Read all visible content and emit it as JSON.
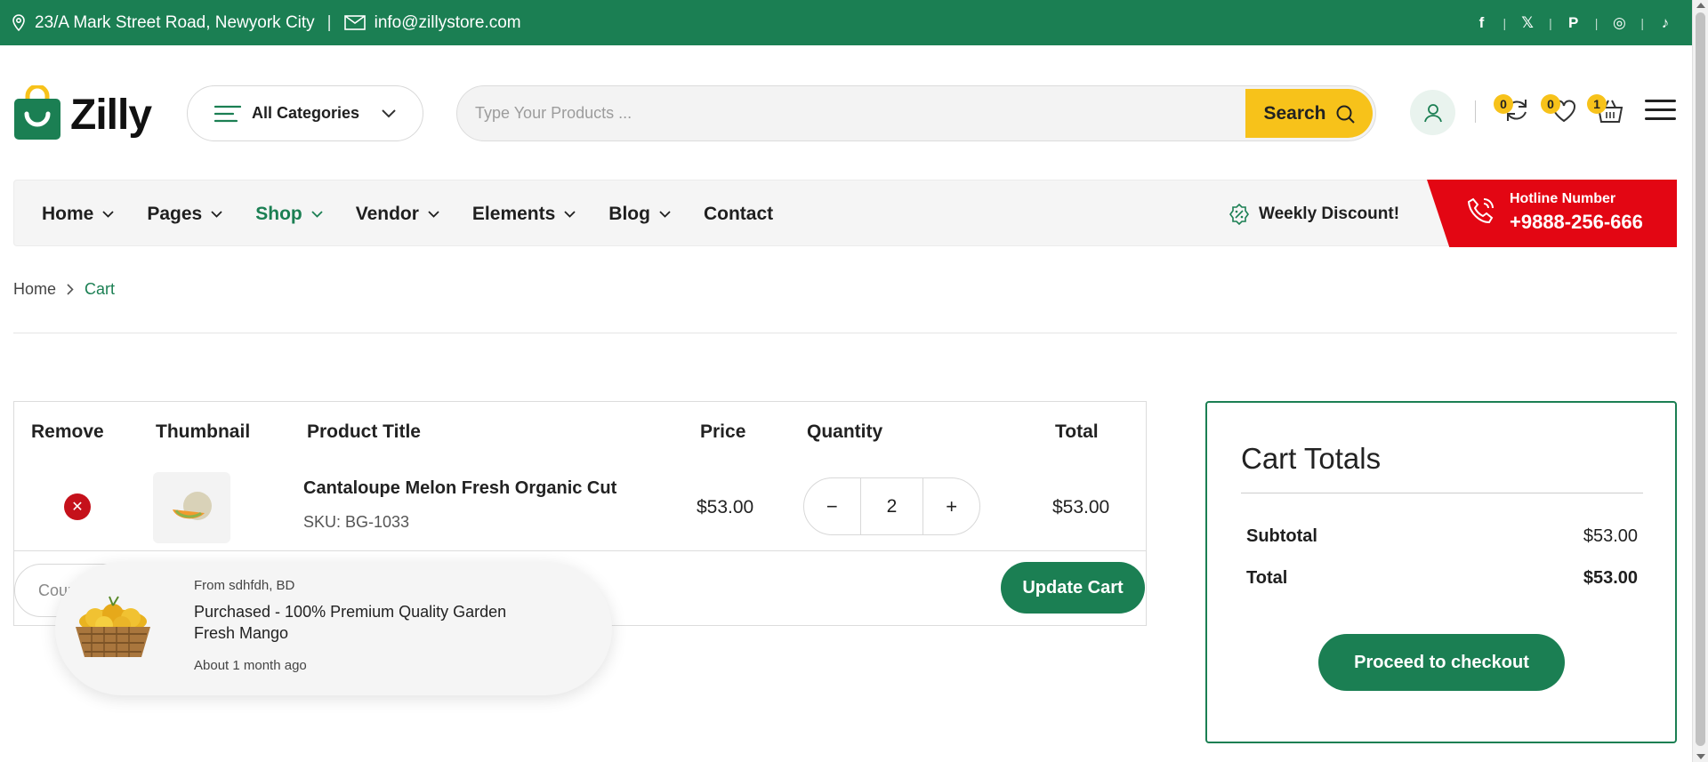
{
  "topbar": {
    "address": "23/A Mark Street Road, Newyork City",
    "separator": "|",
    "email": "info@zillystore.com",
    "social": [
      "f",
      "𝕏",
      "P",
      "◎",
      "♪"
    ],
    "social_names": [
      "facebook-icon",
      "x-icon",
      "pinterest-icon",
      "instagram-icon",
      "tiktok-icon"
    ],
    "bg_color": "#1b7f53"
  },
  "header": {
    "logo_text": "Zilly",
    "categories_label": "All Categories",
    "search_placeholder": "Type Your Products ...",
    "search_button": "Search",
    "compare_count": "0",
    "wishlist_count": "0",
    "cart_count": "1"
  },
  "nav": {
    "items": [
      {
        "label": "Home",
        "dropdown": true
      },
      {
        "label": "Pages",
        "dropdown": true
      },
      {
        "label": "Shop",
        "dropdown": true,
        "active": true
      },
      {
        "label": "Vendor",
        "dropdown": true
      },
      {
        "label": "Elements",
        "dropdown": true
      },
      {
        "label": "Blog",
        "dropdown": true
      },
      {
        "label": "Contact",
        "dropdown": false
      }
    ],
    "weekly_discount": "Weekly Discount!",
    "hotline_label": "Hotline Number",
    "hotline_number": "+9888-256-666"
  },
  "breadcrumb": {
    "home": "Home",
    "current": "Cart"
  },
  "cart": {
    "headers": {
      "remove": "Remove",
      "thumbnail": "Thumbnail",
      "title": "Product Title",
      "price": "Price",
      "quantity": "Quantity",
      "total": "Total"
    },
    "item": {
      "title": "Cantaloupe Melon Fresh Organic Cut",
      "sku": "SKU: BG-1033",
      "price": "$53.00",
      "quantity": "2",
      "total": "$53.00"
    },
    "coupon_placeholder": "Coupon Code",
    "update_button": "Update Cart"
  },
  "toast": {
    "from": "From sdhfdh, BD",
    "product": "Purchased - 100% Premium Quality Garden Fresh Mango",
    "time": "About 1 month ago"
  },
  "totals": {
    "title": "Cart Totals",
    "subtotal_label": "Subtotal",
    "subtotal_value": "$53.00",
    "total_label": "Total",
    "total_value": "$53.00",
    "checkout_button": "Proceed to checkout"
  }
}
